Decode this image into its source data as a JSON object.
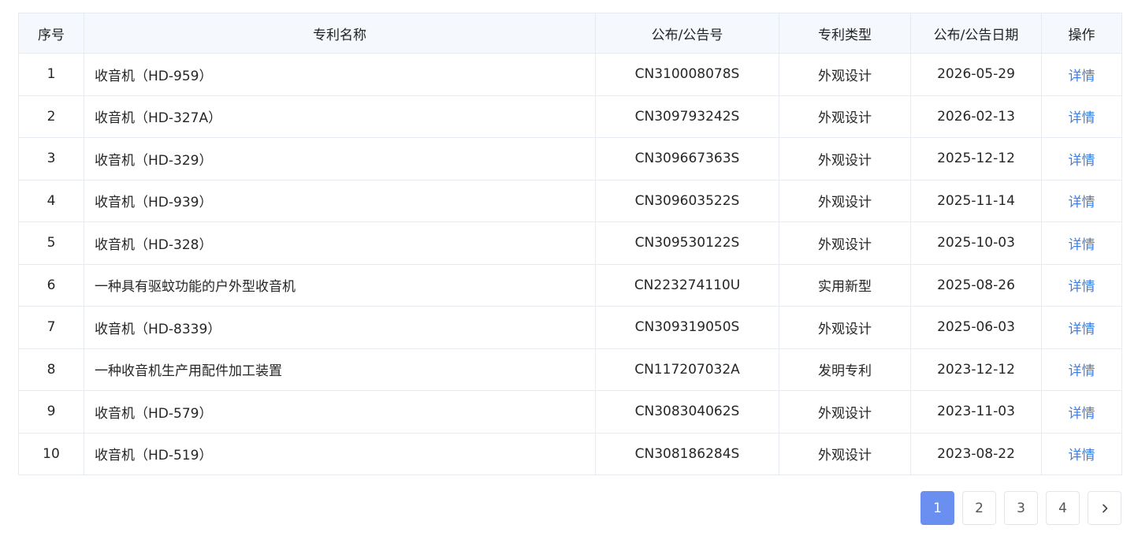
{
  "table": {
    "headers": {
      "index": "序号",
      "name": "专利名称",
      "pub_no": "公布/公告号",
      "type": "专利类型",
      "date": "公布/公告日期",
      "action": "操作"
    },
    "rows": [
      {
        "index": "1",
        "name": "收音机（HD-959）",
        "pub_no": "CN310008078S",
        "type": "外观设计",
        "date": "2026-05-29",
        "action": "详情"
      },
      {
        "index": "2",
        "name": "收音机（HD-327A）",
        "pub_no": "CN309793242S",
        "type": "外观设计",
        "date": "2026-02-13",
        "action": "详情"
      },
      {
        "index": "3",
        "name": "收音机（HD-329）",
        "pub_no": "CN309667363S",
        "type": "外观设计",
        "date": "2025-12-12",
        "action": "详情"
      },
      {
        "index": "4",
        "name": "收音机（HD-939）",
        "pub_no": "CN309603522S",
        "type": "外观设计",
        "date": "2025-11-14",
        "action": "详情"
      },
      {
        "index": "5",
        "name": "收音机（HD-328）",
        "pub_no": "CN309530122S",
        "type": "外观设计",
        "date": "2025-10-03",
        "action": "详情"
      },
      {
        "index": "6",
        "name": "一种具有驱蚊功能的户外型收音机",
        "pub_no": "CN223274110U",
        "type": "实用新型",
        "date": "2025-08-26",
        "action": "详情"
      },
      {
        "index": "7",
        "name": "收音机（HD-8339）",
        "pub_no": "CN309319050S",
        "type": "外观设计",
        "date": "2025-06-03",
        "action": "详情"
      },
      {
        "index": "8",
        "name": "一种收音机生产用配件加工装置",
        "pub_no": "CN117207032A",
        "type": "发明专利",
        "date": "2023-12-12",
        "action": "详情"
      },
      {
        "index": "9",
        "name": "收音机（HD-579）",
        "pub_no": "CN308304062S",
        "type": "外观设计",
        "date": "2023-11-03",
        "action": "详情"
      },
      {
        "index": "10",
        "name": "收音机（HD-519）",
        "pub_no": "CN308186284S",
        "type": "外观设计",
        "date": "2023-08-22",
        "action": "详情"
      }
    ]
  },
  "pagination": {
    "pages": [
      "1",
      "2",
      "3",
      "4"
    ],
    "current": "1",
    "next_icon": "chevron-right-icon"
  },
  "colors": {
    "accent": "#6a8ff0",
    "link": "#3f7ee0",
    "header_bg": "#f5f8fc",
    "border": "#e6ebf2"
  }
}
